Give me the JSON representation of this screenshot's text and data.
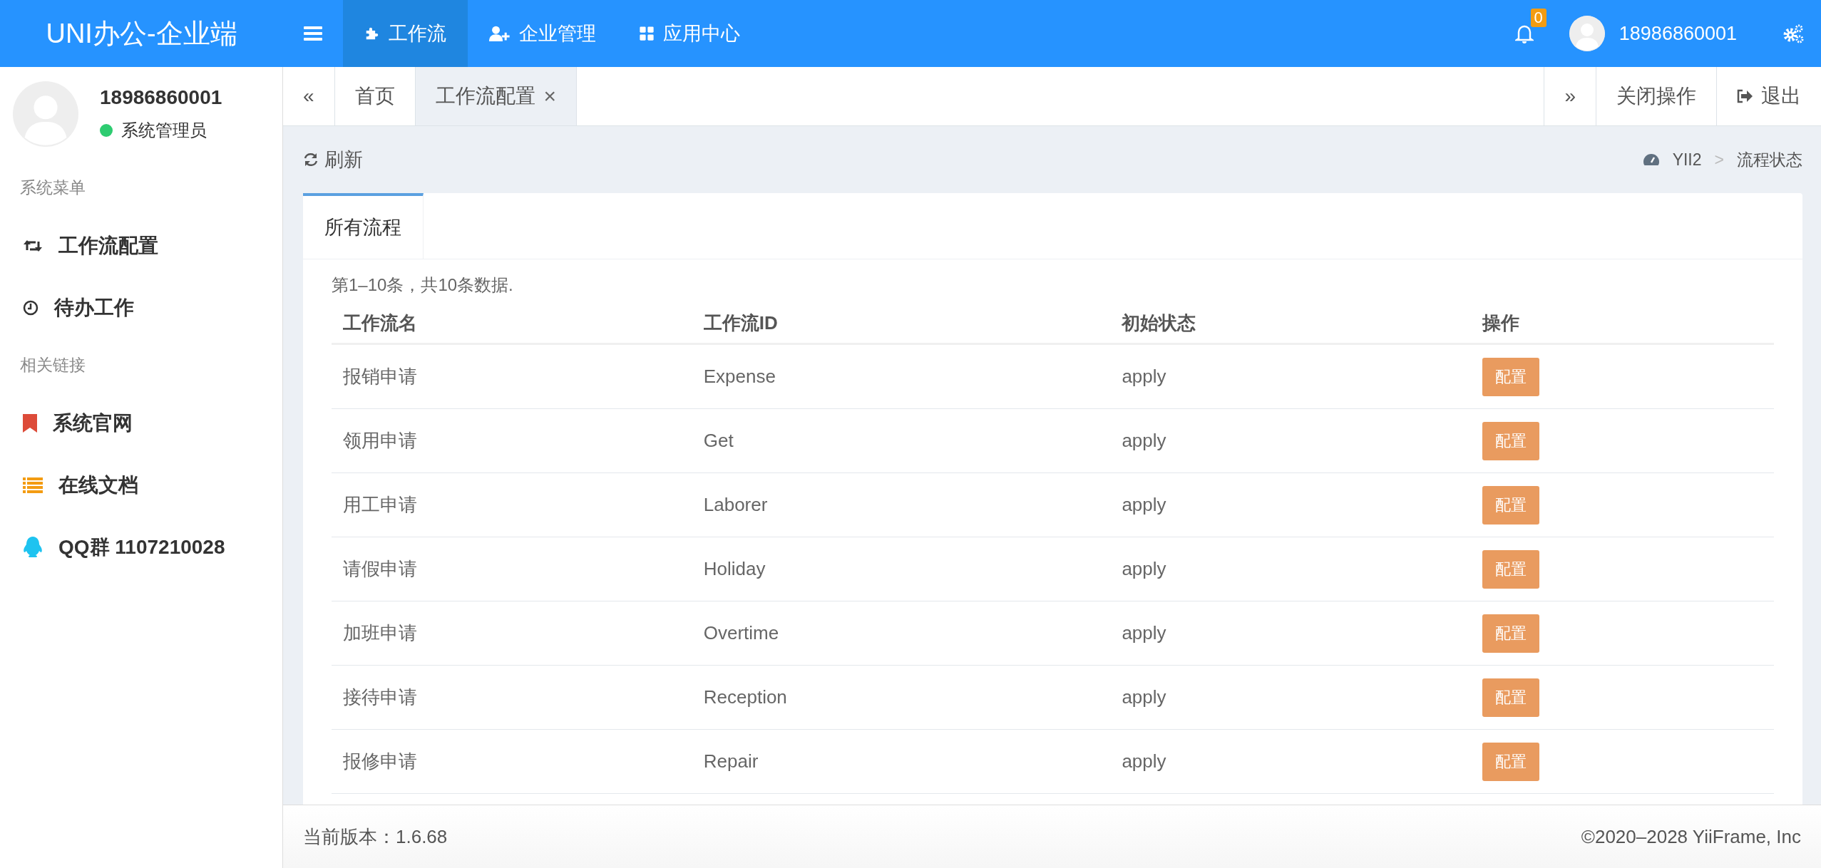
{
  "brand": "UNI办公-企业端",
  "top_nav": [
    {
      "label": "工作流",
      "selected": true
    },
    {
      "label": "企业管理",
      "selected": false
    },
    {
      "label": "应用中心",
      "selected": false
    }
  ],
  "notifications": {
    "count": "0"
  },
  "user_menu": {
    "name": "18986860001"
  },
  "sidebar": {
    "user": {
      "name": "18986860001",
      "role": "系统管理员"
    },
    "sections": [
      {
        "title": "系统菜单",
        "items": [
          {
            "label": "工作流配置"
          },
          {
            "label": "待办工作"
          }
        ]
      },
      {
        "title": "相关链接",
        "items": [
          {
            "label": "系统官网"
          },
          {
            "label": "在线文档"
          },
          {
            "label": "QQ群 1107210028"
          }
        ]
      }
    ]
  },
  "page_tabs": {
    "scroll_left": "«",
    "tabs": [
      {
        "label": "首页",
        "selected": false,
        "closable": false
      },
      {
        "label": "工作流配置",
        "selected": true,
        "closable": true
      }
    ],
    "close_mark": "×",
    "scroll_right": "»",
    "close_ops": "关闭操作",
    "logout": "退出"
  },
  "toolbar": {
    "refresh": "刷新",
    "breadcrumb": [
      "YII2",
      "流程状态"
    ],
    "separator": ">"
  },
  "card": {
    "tabs": [
      {
        "label": "所有流程",
        "selected": true
      }
    ],
    "summary": "第1–10条，共10条数据.",
    "table": {
      "columns": [
        "工作流名",
        "工作流ID",
        "初始状态",
        "操作"
      ],
      "rows": [
        [
          "报销申请",
          "Expense",
          "apply",
          "配置"
        ],
        [
          "领用申请",
          "Get",
          "apply",
          "配置"
        ],
        [
          "用工申请",
          "Laborer",
          "apply",
          "配置"
        ],
        [
          "请假申请",
          "Holiday",
          "apply",
          "配置"
        ],
        [
          "加班申请",
          "Overtime",
          "apply",
          "配置"
        ],
        [
          "接待申请",
          "Reception",
          "apply",
          "配置"
        ],
        [
          "报修申请",
          "Repair",
          "apply",
          "配置"
        ]
      ]
    }
  },
  "footer": {
    "version": "当前版本：1.6.68",
    "copyright": "©2020–2028 YiiFrame, Inc"
  }
}
